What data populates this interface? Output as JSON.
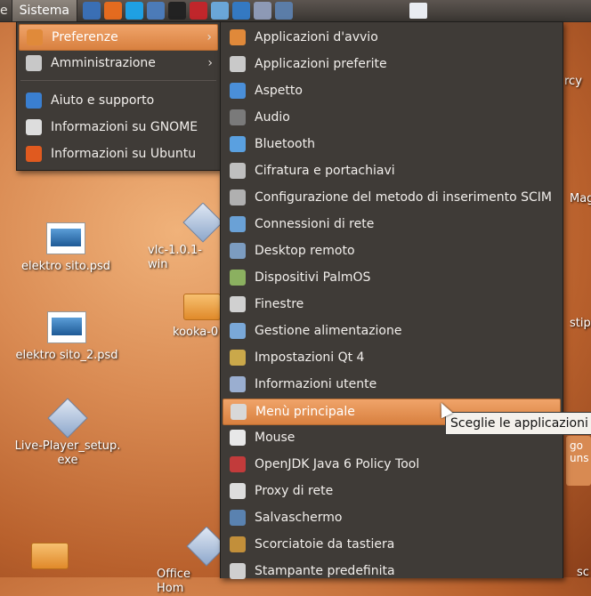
{
  "panel": {
    "cut_label": "e",
    "sistema_label": "Sistema",
    "launchers": [
      {
        "name": "network-icon",
        "color": "#3a6fb5"
      },
      {
        "name": "firefox-icon",
        "color": "#e46b1f"
      },
      {
        "name": "skype-icon",
        "color": "#1fa0e3"
      },
      {
        "name": "thunderbird-icon",
        "color": "#4c7bb8"
      },
      {
        "name": "terminal-icon",
        "color": "#222222"
      },
      {
        "name": "pdf-icon",
        "color": "#c0262b"
      },
      {
        "name": "dreamweaver-icon",
        "color": "#6aa6d8"
      },
      {
        "name": "virtualbox-icon",
        "color": "#3479c2"
      },
      {
        "name": "globe-icon",
        "color": "#8d99b5"
      },
      {
        "name": "disk-icon",
        "color": "#5b7da8"
      }
    ]
  },
  "menu_sistema": [
    {
      "label": "Preferenze",
      "icon": "preferences-icon",
      "submenu": true,
      "highlighted": true
    },
    {
      "label": "Amministrazione",
      "icon": "administration-icon",
      "submenu": true,
      "highlighted": false
    },
    {
      "label": "Aiuto e supporto",
      "icon": "help-icon",
      "submenu": false,
      "highlighted": false
    },
    {
      "label": "Informazioni su GNOME",
      "icon": "gnome-icon",
      "submenu": false,
      "highlighted": false
    },
    {
      "label": "Informazioni su Ubuntu",
      "icon": "ubuntu-icon",
      "submenu": false,
      "highlighted": false
    }
  ],
  "menu_preferenze": [
    {
      "label": "Applicazioni d'avvio",
      "icon": "startup-apps-icon"
    },
    {
      "label": "Applicazioni preferite",
      "icon": "preferred-apps-icon"
    },
    {
      "label": "Aspetto",
      "icon": "appearance-icon"
    },
    {
      "label": "Audio",
      "icon": "audio-icon"
    },
    {
      "label": "Bluetooth",
      "icon": "bluetooth-icon"
    },
    {
      "label": "Cifratura e portachiavi",
      "icon": "encryption-icon"
    },
    {
      "label": "Configurazione del metodo di inserimento SCIM",
      "icon": "scim-icon"
    },
    {
      "label": "Connessioni di rete",
      "icon": "network-connections-icon"
    },
    {
      "label": "Desktop remoto",
      "icon": "remote-desktop-icon"
    },
    {
      "label": "Dispositivi PalmOS",
      "icon": "palm-icon"
    },
    {
      "label": "Finestre",
      "icon": "windows-icon"
    },
    {
      "label": "Gestione alimentazione",
      "icon": "power-icon"
    },
    {
      "label": "Impostazioni Qt 4",
      "icon": "qt-icon"
    },
    {
      "label": "Informazioni utente",
      "icon": "user-info-icon"
    },
    {
      "label": "Menù principale",
      "icon": "main-menu-icon",
      "highlighted": true
    },
    {
      "label": "Mouse",
      "icon": "mouse-icon"
    },
    {
      "label": "OpenJDK Java 6 Policy Tool",
      "icon": "java-icon"
    },
    {
      "label": "Proxy di rete",
      "icon": "proxy-icon"
    },
    {
      "label": "Salvaschermo",
      "icon": "screensaver-icon"
    },
    {
      "label": "Scorciatoie da tastiera",
      "icon": "keyboard-icon"
    },
    {
      "label": "Stampante predefinita",
      "icon": "printer-icon"
    }
  ],
  "tooltip": "Sceglie le applicazioni da",
  "desktop": {
    "icon1": "elektro sito.psd",
    "icon2": "elektro sito_2.psd",
    "icon3_line1": "Live-Player_setup.",
    "icon3_line2": "exe",
    "icon4": "vlc-1.0.1-win",
    "icon5": "kooka-0",
    "icon6": "Office Hom",
    "peek_rcy": "rcy",
    "peek_mag": "Mag",
    "peek_stip": "stip",
    "peek_sc": "sc",
    "note": "go uns"
  }
}
